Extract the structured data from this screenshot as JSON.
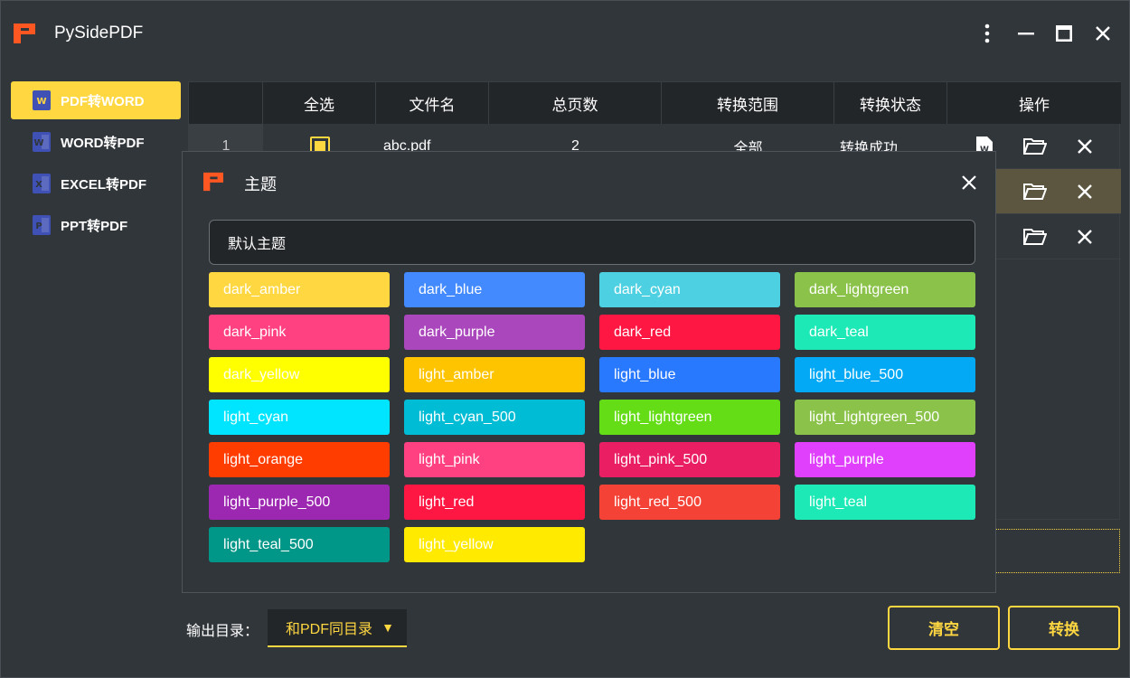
{
  "app": {
    "title": "PySidePDF"
  },
  "sidebar": {
    "items": [
      {
        "label": "PDF转WORD",
        "icon": "word-doc-icon"
      },
      {
        "label": "WORD转PDF",
        "icon": "word-doc-icon"
      },
      {
        "label": "EXCEL转PDF",
        "icon": "excel-doc-icon"
      },
      {
        "label": "PPT转PDF",
        "icon": "ppt-doc-icon"
      }
    ]
  },
  "table": {
    "headers": [
      "",
      "全选",
      "文件名",
      "总页数",
      "转换范围",
      "转换状态",
      "操作"
    ],
    "rows": [
      {
        "index": "1",
        "filename": "abc.pdf",
        "pages": "2",
        "range": "全部",
        "status": "转换成功"
      }
    ]
  },
  "bottom": {
    "output_label": "输出目录：",
    "output_select": "和PDF同目录",
    "clear_label": "清空",
    "convert_label": "转换"
  },
  "dialog": {
    "title": "主题",
    "default_theme": "默认主题",
    "themes": [
      {
        "name": "dark_amber",
        "color": "#ffd740"
      },
      {
        "name": "dark_blue",
        "color": "#448aff"
      },
      {
        "name": "dark_cyan",
        "color": "#4dd0e1"
      },
      {
        "name": "dark_lightgreen",
        "color": "#8bc34a"
      },
      {
        "name": "dark_pink",
        "color": "#ff4081"
      },
      {
        "name": "dark_purple",
        "color": "#ab47bc"
      },
      {
        "name": "dark_red",
        "color": "#ff1744"
      },
      {
        "name": "dark_teal",
        "color": "#1de9b6"
      },
      {
        "name": "dark_yellow",
        "color": "#ffff00"
      },
      {
        "name": "light_amber",
        "color": "#ffc400"
      },
      {
        "name": "light_blue",
        "color": "#2979ff"
      },
      {
        "name": "light_blue_500",
        "color": "#03a9f4"
      },
      {
        "name": "light_cyan",
        "color": "#00e5ff"
      },
      {
        "name": "light_cyan_500",
        "color": "#00bcd4"
      },
      {
        "name": "light_lightgreen",
        "color": "#64dd17"
      },
      {
        "name": "light_lightgreen_500",
        "color": "#8bc34a"
      },
      {
        "name": "light_orange",
        "color": "#ff3d00"
      },
      {
        "name": "light_pink",
        "color": "#ff4081"
      },
      {
        "name": "light_pink_500",
        "color": "#e91e63"
      },
      {
        "name": "light_purple",
        "color": "#e040fb"
      },
      {
        "name": "light_purple_500",
        "color": "#9c27b0"
      },
      {
        "name": "light_red",
        "color": "#ff1744"
      },
      {
        "name": "light_red_500",
        "color": "#f44336"
      },
      {
        "name": "light_teal",
        "color": "#1de9b6"
      },
      {
        "name": "light_teal_500",
        "color": "#009688"
      },
      {
        "name": "light_yellow",
        "color": "#ffea00"
      }
    ]
  },
  "colors": {
    "accent": "#ffd740",
    "background": "#31363b",
    "logo": "#ff5722"
  }
}
